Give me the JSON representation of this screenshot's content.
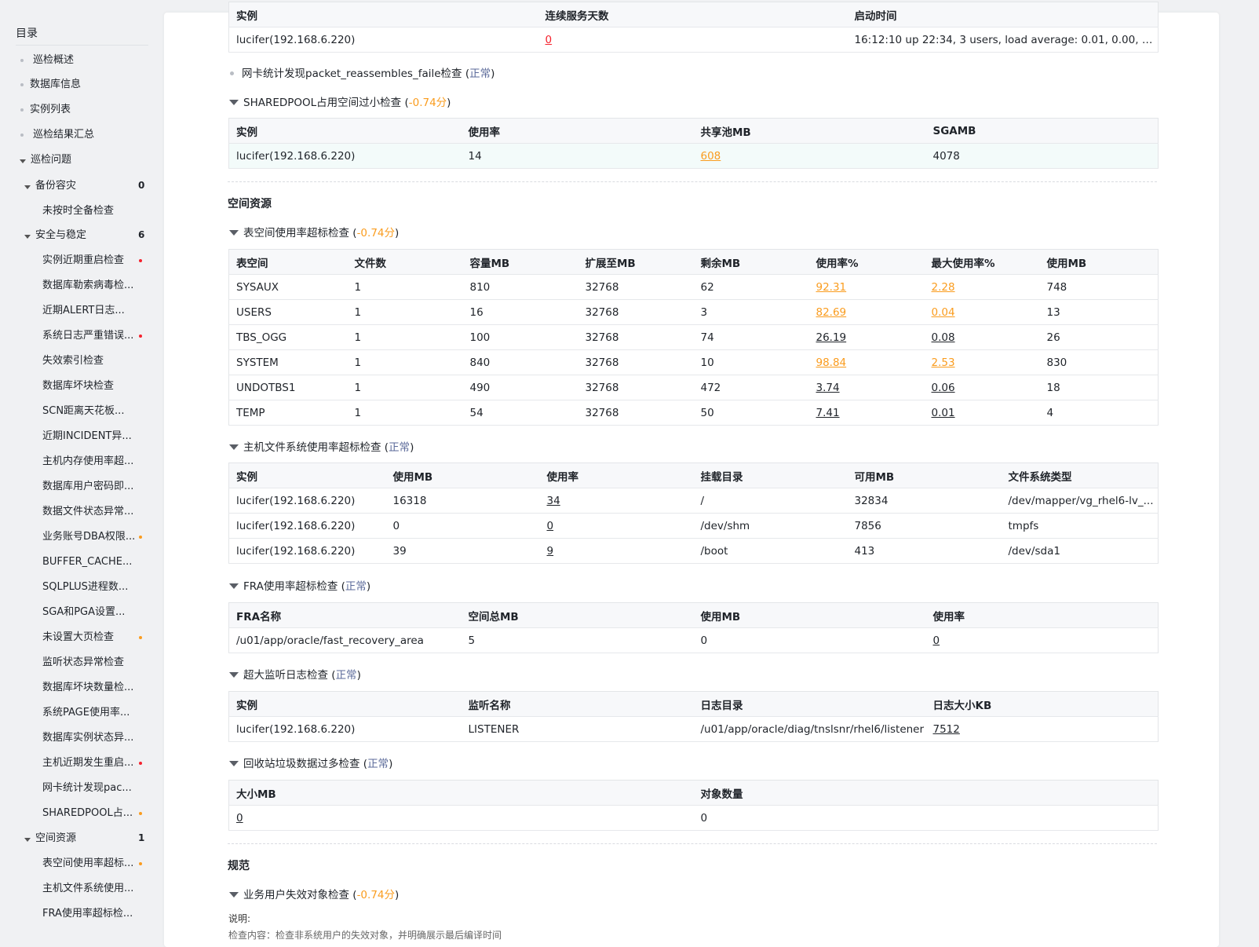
{
  "toc": {
    "title": "目录",
    "items": [
      {
        "label": "巡检概述"
      },
      {
        "label": "数据库信息"
      },
      {
        "label": "实例列表"
      },
      {
        "label": "巡检结果汇总"
      },
      {
        "label": "巡检问题"
      },
      {
        "label": "备份容灾",
        "count": "0"
      },
      {
        "label": "未按时全备检查"
      },
      {
        "label": "安全与稳定",
        "count": "6"
      },
      {
        "label": "实例近期重启检查",
        "flag": "red"
      },
      {
        "label": "数据库勒索病毒检..."
      },
      {
        "label": "近期ALERT日志..."
      },
      {
        "label": "系统日志严重错误...",
        "flag": "red"
      },
      {
        "label": "失效索引检查"
      },
      {
        "label": "数据库坏块检查"
      },
      {
        "label": "SCN距离天花板..."
      },
      {
        "label": "近期INCIDENT异..."
      },
      {
        "label": "主机内存使用率超..."
      },
      {
        "label": "数据库用户密码即..."
      },
      {
        "label": "数据文件状态异常..."
      },
      {
        "label": "业务账号DBA权限...",
        "flag": "orange"
      },
      {
        "label": "BUFFER_CACHE..."
      },
      {
        "label": "SQLPLUS进程数..."
      },
      {
        "label": "SGA和PGA设置..."
      },
      {
        "label": "未设置大页检查",
        "flag": "orange"
      },
      {
        "label": "监听状态异常检查"
      },
      {
        "label": "数据库坏块数量检..."
      },
      {
        "label": "系统PAGE使用率..."
      },
      {
        "label": "数据库实例状态异..."
      },
      {
        "label": "主机近期发生重启...",
        "flag": "red"
      },
      {
        "label": "网卡统计发现pac..."
      },
      {
        "label": "SHAREDPOOL占...",
        "flag": "orange"
      },
      {
        "label": "空间资源",
        "count": "1"
      },
      {
        "label": "表空间使用率超标...",
        "flag": "orange"
      },
      {
        "label": "主机文件系统使用..."
      },
      {
        "label": "FRA使用率超标检..."
      }
    ]
  },
  "top_table": {
    "headers": [
      "实例",
      "连续服务天数",
      "启动时间"
    ],
    "row": [
      "lucifer(192.168.6.220)",
      "0",
      "16:12:10 up 22:34, 3 users, load average: 0.01, 0.00, 0.00"
    ]
  },
  "nic_check": {
    "title": "网卡统计发现packet_reassembles_faile检查 (",
    "status": "正常",
    "close": ")"
  },
  "sharedpool": {
    "title": "SHAREDPOOL占用空间过小检查 (",
    "score": "-0.74分",
    "close": ")",
    "headers": [
      "实例",
      "使用率",
      "共享池MB",
      "SGAMB"
    ],
    "row": [
      "lucifer(192.168.6.220)",
      "14",
      "608",
      "4078"
    ]
  },
  "section_space": "空间资源",
  "tablespace": {
    "title": "表空间使用率超标检查 (",
    "score": "-0.74分",
    "close": ")",
    "headers": [
      "表空间",
      "文件数",
      "容量MB",
      "扩展至MB",
      "剩余MB",
      "使用率%",
      "最大使用率%",
      "使用MB"
    ],
    "rows": [
      [
        "SYSAUX",
        "1",
        "810",
        "32768",
        "62",
        "92.31",
        "2.28",
        "748"
      ],
      [
        "USERS",
        "1",
        "16",
        "32768",
        "3",
        "82.69",
        "0.04",
        "13"
      ],
      [
        "TBS_OGG",
        "1",
        "100",
        "32768",
        "74",
        "26.19",
        "0.08",
        "26"
      ],
      [
        "SYSTEM",
        "1",
        "840",
        "32768",
        "10",
        "98.84",
        "2.53",
        "830"
      ],
      [
        "UNDOTBS1",
        "1",
        "490",
        "32768",
        "472",
        "3.74",
        "0.06",
        "18"
      ],
      [
        "TEMP",
        "1",
        "54",
        "32768",
        "50",
        "7.41",
        "0.01",
        "4"
      ]
    ],
    "warn_rows": [
      0,
      1,
      3
    ]
  },
  "fs": {
    "title": "主机文件系统使用率超标检查 (",
    "status": "正常",
    "close": ")",
    "headers": [
      "实例",
      "使用MB",
      "使用率",
      "挂载目录",
      "可用MB",
      "文件系统类型"
    ],
    "rows": [
      [
        "lucifer(192.168.6.220)",
        "16318",
        "34",
        "/",
        "32834",
        "/dev/mapper/vg_rhel6-lv_..."
      ],
      [
        "lucifer(192.168.6.220)",
        "0",
        "0",
        "/dev/shm",
        "7856",
        "tmpfs"
      ],
      [
        "lucifer(192.168.6.220)",
        "39",
        "9",
        "/boot",
        "413",
        "/dev/sda1"
      ]
    ]
  },
  "fra": {
    "title": "FRA使用率超标检查 (",
    "status": "正常",
    "close": ")",
    "headers": [
      "FRA名称",
      "空间总MB",
      "使用MB",
      "使用率"
    ],
    "row": [
      "/u01/app/oracle/fast_recovery_area",
      "5",
      "0",
      "0"
    ]
  },
  "listener": {
    "title": "超大监听日志检查 (",
    "status": "正常",
    "close": ")",
    "headers": [
      "实例",
      "监听名称",
      "日志目录",
      "日志大小KB"
    ],
    "row": [
      "lucifer(192.168.6.220)",
      "LISTENER",
      "/u01/app/oracle/diag/tnslsnr/rhel6/listener",
      "7512"
    ]
  },
  "recyclebin": {
    "title": "回收站垃圾数据过多检查 (",
    "status": "正常",
    "close": ")",
    "headers": [
      "大小MB",
      "对象数量"
    ],
    "row": [
      "0",
      "0"
    ]
  },
  "section_norm": "规范",
  "invalid_obj": {
    "title": "业务用户失效对象检查 (",
    "score": "-0.74分",
    "close": ")"
  },
  "note": {
    "label": "说明:",
    "text": "检查内容：检查非系统用户的失效对象，并明确展示最后编译时间"
  },
  "colors": {
    "warn": "#fa9c1e",
    "danger": "#f5222d",
    "ok": "#5b6a9a"
  }
}
